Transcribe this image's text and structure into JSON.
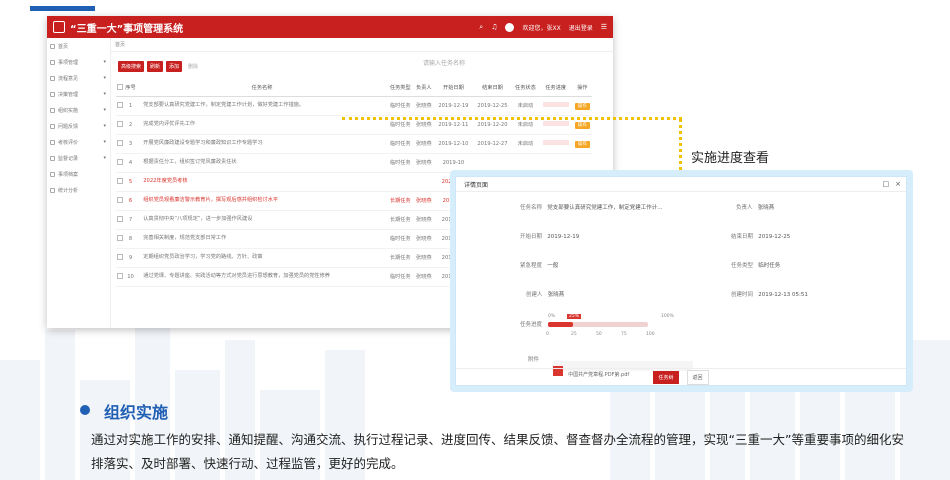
{
  "header": {
    "title": "“三重一大”事项管理系统",
    "user": "欢迎您，张XX",
    "logout": "退出登录"
  },
  "breadcrumb": "首页",
  "sidebar": {
    "items": [
      {
        "label": "事项管理"
      },
      {
        "label": "流程意见"
      },
      {
        "label": "决策管理"
      },
      {
        "label": "组织实施"
      },
      {
        "label": "问题反馈"
      },
      {
        "label": "考核评价"
      },
      {
        "label": "监督记录"
      },
      {
        "label": "事项档案"
      },
      {
        "label": "统计分析"
      }
    ]
  },
  "toolbar": {
    "buttons": [
      "高级搜索",
      "刷新",
      "添加"
    ],
    "disabled_btn": "删除",
    "search_placeholder": "请输入任务名称",
    "search_btn": "搜索"
  },
  "table": {
    "headers": [
      "序号",
      "任务名称",
      "任务类型",
      "负责人",
      "开始日期",
      "结束日期",
      "任务状态",
      "任务进度",
      "操作"
    ],
    "rows": [
      {
        "no": "1",
        "name": "党支部要认真研究党建工作，制定党建工作计划，做好党建工作措施。",
        "type": "临时任务",
        "owner": "张晓燕",
        "start": "2019-12-19",
        "end": "2019-12-25",
        "status": "未启动",
        "op": "操作",
        "red": false
      },
      {
        "no": "2",
        "name": "完成党内评优评先工作",
        "type": "临时任务",
        "owner": "张晓燕",
        "start": "2019-12-11",
        "end": "2019-12-20",
        "status": "未启动",
        "op": "操作",
        "red": false
      },
      {
        "no": "3",
        "name": "开展党风廉政建设专题学习和廉政知识工作专题学习",
        "type": "临时任务",
        "owner": "张晓燕",
        "start": "2019-12-10",
        "end": "2019-12-27",
        "status": "未启动",
        "op": "操作",
        "red": false
      },
      {
        "no": "4",
        "name": "根据责任分工，组织签订党风廉政责任状",
        "type": "临时任务",
        "owner": "张晓燕",
        "start": "2019-10",
        "end": "",
        "status": "",
        "op": "",
        "red": false
      },
      {
        "no": "5",
        "name": "2022年度党员考核",
        "type": "",
        "owner": "",
        "start": "2022-01-",
        "end": "",
        "status": "",
        "op": "",
        "red": true
      },
      {
        "no": "6",
        "name": "组织党员观看廉洁警示教育片，撰写观后感并组织检讨水平",
        "type": "长期任务",
        "owner": "张晓燕",
        "start": "2019-10",
        "end": "",
        "status": "",
        "op": "",
        "red": true
      },
      {
        "no": "7",
        "name": "认真贯彻中央“八项规定”，进一步加强作风建设",
        "type": "长期任务",
        "owner": "张晓燕",
        "start": "2019-09-",
        "end": "",
        "status": "",
        "op": "",
        "red": false
      },
      {
        "no": "8",
        "name": "完善相关制度，规范党支部日常工作",
        "type": "临时任务",
        "owner": "张晓燕",
        "start": "2019-09-",
        "end": "",
        "status": "",
        "op": "",
        "red": false
      },
      {
        "no": "9",
        "name": "定期组织党员政治学习，学习党的路线、方针、政策",
        "type": "长期任务",
        "owner": "张晓燕",
        "start": "2019-09-",
        "end": "",
        "status": "",
        "op": "",
        "red": false
      },
      {
        "no": "10",
        "name": "通过党课、专题讲座、实践活动等方式对党员进行思想教育，加强党员的党性修养",
        "type": "临时任务",
        "owner": "张晓燕",
        "start": "2019-09-",
        "end": "",
        "status": "",
        "op": "",
        "red": false
      }
    ]
  },
  "callout": "实施进度查看",
  "dialog": {
    "title": "详情页面",
    "fields": {
      "name_label": "任务名称",
      "name_value": "党支部要认真研究党建工作，制定党建工作计...",
      "owner_label": "负责人",
      "owner_value": "张晓燕",
      "start_label": "开始日期",
      "start_value": "2019-12-19",
      "end_label": "结束日期",
      "end_value": "2019-12-25",
      "urgency_label": "紧急程度",
      "urgency_value": "一般",
      "type_label": "任务类型",
      "type_value": "临时任务",
      "creator_label": "创建人",
      "creator_value": "张晓燕",
      "created_label": "创建时间",
      "created_value": "2019-12-13 05:51",
      "progress_label": "任务进度",
      "progress_value": 0.25,
      "progress_tag": "25%",
      "progress_min": "0%",
      "progress_max": "100%",
      "ticks": [
        "0",
        "25",
        "50",
        "75",
        "100"
      ],
      "attach_label": "附件",
      "attach_value": "中国共产党章程.PDF第.pdf"
    },
    "btn_primary": "任务树",
    "btn_back": "返回"
  },
  "section": {
    "title": "组织实施",
    "body": "通过对实施工作的安排、通知提醒、沟通交流、执行过程记录、进度回传、结果反馈、督查督办全流程的管理，实现“三重一大”等重要事项的细化安排落实、及时部署、快速行动、过程监管，更好的完成。"
  },
  "colors": {
    "brand_red": "#c81f1f",
    "accent_blue": "#1f5fb4",
    "connector": "#f2c200"
  }
}
